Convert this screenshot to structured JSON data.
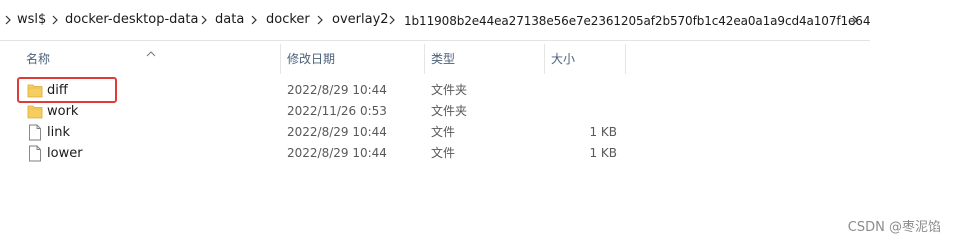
{
  "breadcrumb": {
    "segments": [
      "wsl$",
      "docker-desktop-data",
      "data",
      "docker",
      "overlay2",
      "1b11908b2e44ea27138e56e7e2361205af2b570fb1c42ea0a1a9cd4a107f1e64"
    ]
  },
  "columns": {
    "name": "名称",
    "date": "修改日期",
    "type": "类型",
    "size": "大小"
  },
  "rows": [
    {
      "name": "diff",
      "date": "2022/8/29 10:44",
      "type": "文件夹",
      "size": "",
      "icon": "folder-icon"
    },
    {
      "name": "work",
      "date": "2022/11/26 0:53",
      "type": "文件夹",
      "size": "",
      "icon": "folder-icon"
    },
    {
      "name": "link",
      "date": "2022/8/29 10:44",
      "type": "文件",
      "size": "1 KB",
      "icon": "file-icon"
    },
    {
      "name": "lower",
      "date": "2022/8/29 10:44",
      "type": "文件",
      "size": "1 KB",
      "icon": "file-icon"
    }
  ],
  "watermark": "CSDN @枣泥馅",
  "colors": {
    "folder": "#f6ce5f",
    "highlight": "#e03b3b",
    "header_text": "#4c607a"
  }
}
